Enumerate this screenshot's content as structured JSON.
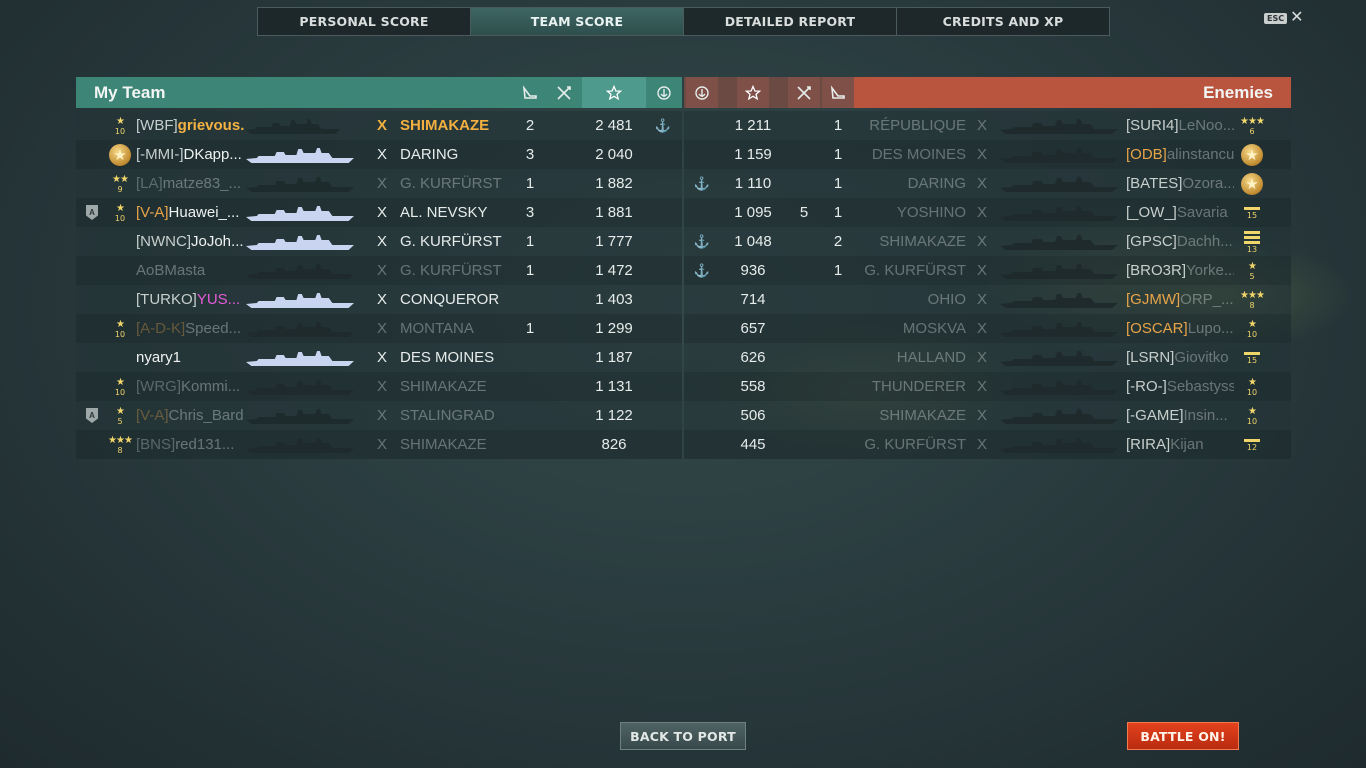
{
  "tabs": [
    "PERSONAL SCORE",
    "TEAM SCORE",
    "DETAILED REPORT",
    "CREDITS AND XP"
  ],
  "active_tab": "TEAM SCORE",
  "esc_key": "ESC",
  "close_glyph": "✕",
  "my_team_title": "My Team",
  "enemies_title": "Enemies",
  "destroyed_marker": "X",
  "my_team": [
    {
      "level": "10",
      "level_style": "star1",
      "division": false,
      "clan": "[WBF]",
      "name": "grievous...",
      "player_style": "self",
      "ship": "SHIMAKAZE",
      "alive": true,
      "planes": "2",
      "kills": "",
      "score": "2 481",
      "base": "⚓"
    },
    {
      "level": "",
      "level_style": "medal",
      "division": false,
      "clan": "[-MMI-]",
      "name": "DKapp...",
      "player_style": "normal",
      "ship": "DARING",
      "alive": true,
      "planes": "3",
      "kills": "",
      "score": "2 040",
      "base": ""
    },
    {
      "level": "9",
      "level_style": "star2",
      "division": false,
      "clan": "[LA]",
      "name": "matze83_...",
      "player_style": "normal",
      "ship": "G. KURFÜRST",
      "alive": false,
      "planes": "1",
      "kills": "",
      "score": "1 882",
      "base": ""
    },
    {
      "level": "10",
      "level_style": "star1",
      "division": true,
      "division_label": "A",
      "clan": "[V-A]",
      "name": "Huawei_...",
      "player_style": "divclan",
      "ship": "AL. NEVSKY",
      "alive": true,
      "planes": "3",
      "kills": "",
      "score": "1 881",
      "base": ""
    },
    {
      "level": "",
      "level_style": "none",
      "division": false,
      "clan": "[NWNC]",
      "name": "JoJoh...",
      "player_style": "normal",
      "ship": "G. KURFÜRST",
      "alive": true,
      "planes": "1",
      "kills": "",
      "score": "1 777",
      "base": ""
    },
    {
      "level": "",
      "level_style": "none",
      "division": false,
      "clan": "",
      "name": "AoBMasta",
      "player_style": "normal",
      "ship": "G. KURFÜRST",
      "alive": false,
      "planes": "1",
      "kills": "",
      "score": "1 472",
      "base": ""
    },
    {
      "level": "",
      "level_style": "none",
      "division": false,
      "clan": "[TURKO]",
      "name": "YUS...",
      "player_style": "pink",
      "ship": "CONQUEROR",
      "alive": true,
      "planes": "",
      "kills": "",
      "score": "1 403",
      "base": ""
    },
    {
      "level": "10",
      "level_style": "star1",
      "division": false,
      "clan": "[A-D-K]",
      "name": "Speed...",
      "player_style": "goldclan",
      "ship": "MONTANA",
      "alive": false,
      "planes": "1",
      "kills": "",
      "score": "1 299",
      "base": ""
    },
    {
      "level": "",
      "level_style": "none",
      "division": false,
      "clan": "",
      "name": "nyary1",
      "player_style": "normal",
      "ship": "DES MOINES",
      "alive": true,
      "planes": "",
      "kills": "",
      "score": "1 187",
      "base": ""
    },
    {
      "level": "10",
      "level_style": "star1",
      "division": false,
      "clan": "[WRG]",
      "name": "Kommi...",
      "player_style": "normal",
      "ship": "SHIMAKAZE",
      "alive": false,
      "planes": "",
      "kills": "",
      "score": "1 131",
      "base": ""
    },
    {
      "level": "5",
      "level_style": "star1",
      "division": true,
      "division_label": "A",
      "clan": "[V-A]",
      "name": "Chris_Bard",
      "player_style": "divclan",
      "ship": "STALINGRAD",
      "alive": false,
      "planes": "",
      "kills": "",
      "score": "1 122",
      "base": ""
    },
    {
      "level": "8",
      "level_style": "star3",
      "division": false,
      "clan": "[BNS]",
      "name": "red131...",
      "player_style": "normal",
      "ship": "SHIMAKAZE",
      "alive": false,
      "planes": "",
      "kills": "",
      "score": "826",
      "base": ""
    }
  ],
  "enemies": [
    {
      "base": "",
      "score": "1 211",
      "kills": "",
      "planes": "1",
      "ship": "RÉPUBLIQUE",
      "clan": "[SURI4]",
      "name": "LeNoo...",
      "level": "6",
      "level_style": "star3"
    },
    {
      "base": "",
      "score": "1 159",
      "kills": "",
      "planes": "1",
      "ship": "DES MOINES",
      "clan": "[ODB]",
      "name": "alinstancu",
      "level": "",
      "level_style": "medal",
      "clan_gold": true
    },
    {
      "base": "⚓",
      "score": "1 110",
      "kills": "",
      "planes": "1",
      "ship": "DARING",
      "clan": "[BATES]",
      "name": "Ozora...",
      "level": "",
      "level_style": "medal"
    },
    {
      "base": "",
      "score": "1 095",
      "kills": "5",
      "planes": "1",
      "ship": "YOSHINO",
      "clan": "[_OW_]",
      "name": "Savaria",
      "level": "15",
      "level_style": "bar1"
    },
    {
      "base": "⚓",
      "score": "1 048",
      "kills": "",
      "planes": "2",
      "ship": "SHIMAKAZE",
      "clan": "[GPSC]",
      "name": "Dachh...",
      "level": "13",
      "level_style": "bar3"
    },
    {
      "base": "⚓",
      "score": "936",
      "kills": "",
      "planes": "1",
      "ship": "G. KURFÜRST",
      "clan": "[BRO3R]",
      "name": "Yorke...",
      "level": "5",
      "level_style": "star1"
    },
    {
      "base": "",
      "score": "714",
      "kills": "",
      "planes": "",
      "ship": "OHIO",
      "clan": "[GJMW]",
      "name": "ORP_...",
      "level": "8",
      "level_style": "star3",
      "clan_gold": true
    },
    {
      "base": "",
      "score": "657",
      "kills": "",
      "planes": "",
      "ship": "MOSKVA",
      "clan": "[OSCAR]",
      "name": "Lupo...",
      "level": "10",
      "level_style": "star1",
      "clan_gold": true
    },
    {
      "base": "",
      "score": "626",
      "kills": "",
      "planes": "",
      "ship": "HALLAND",
      "clan": "[LSRN]",
      "name": "Giovitko",
      "level": "15",
      "level_style": "bar1"
    },
    {
      "base": "",
      "score": "558",
      "kills": "",
      "planes": "",
      "ship": "THUNDERER",
      "clan": "[-RO-]",
      "name": "Sebastyss",
      "level": "10",
      "level_style": "star1"
    },
    {
      "base": "",
      "score": "506",
      "kills": "",
      "planes": "",
      "ship": "SHIMAKAZE",
      "clan": "[-GAME]",
      "name": "Insin...",
      "level": "10",
      "level_style": "star1"
    },
    {
      "base": "",
      "score": "445",
      "kills": "",
      "planes": "",
      "ship": "G. KURFÜRST",
      "clan": "[RIRA]",
      "name": "Kijan",
      "level": "12",
      "level_style": "bar1"
    }
  ],
  "buttons": {
    "back_to_port": "BACK TO PORT",
    "battle_on": "BATTLE ON!"
  },
  "colors": {
    "my_team_header": "#3c8577",
    "enemy_header": "#b9553f",
    "self_highlight": "#f2b040",
    "battle_button": "#d2381a"
  }
}
